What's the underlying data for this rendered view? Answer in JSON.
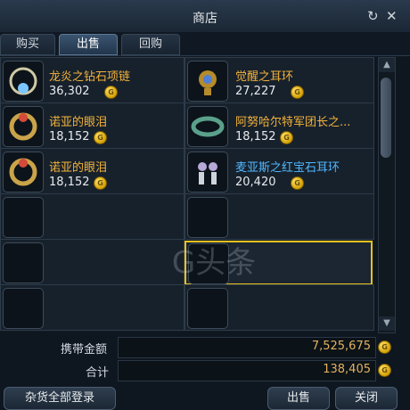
{
  "window": {
    "title": "商店"
  },
  "tabs": [
    {
      "label": "购买"
    },
    {
      "label": "出售"
    },
    {
      "label": "回购"
    }
  ],
  "items": [
    {
      "name": "龙炎之钻石项链",
      "price": "36,302",
      "name_color": "#f2b23a",
      "icon": "diamond-necklace-icon"
    },
    {
      "name": "觉醒之耳环",
      "price": "27,227",
      "name_color": "#f2b23a",
      "icon": "earring-icon"
    },
    {
      "name": "诺亚的眼泪",
      "price": "18,152",
      "name_color": "#f2b23a",
      "icon": "ring-icon"
    },
    {
      "name": "阿努哈尔特军团长之...",
      "price": "18,152",
      "name_color": "#f2b23a",
      "icon": "belt-icon"
    },
    {
      "name": "诺亚的眼泪",
      "price": "18,152",
      "name_color": "#f2b23a",
      "icon": "ring-icon"
    },
    {
      "name": "麦亚斯之红宝石耳环",
      "price": "20,420",
      "name_color": "#4fb6ff",
      "icon": "ruby-earring-icon"
    }
  ],
  "footer": {
    "carry_label": "携带金额",
    "carry_value": "7,525,675",
    "total_label": "合计",
    "total_value": "138,405"
  },
  "buttons": {
    "misc_register": "杂货全部登录",
    "sell": "出售",
    "close": "关闭"
  },
  "coin_glyph": "G",
  "watermark_text": "G头条"
}
